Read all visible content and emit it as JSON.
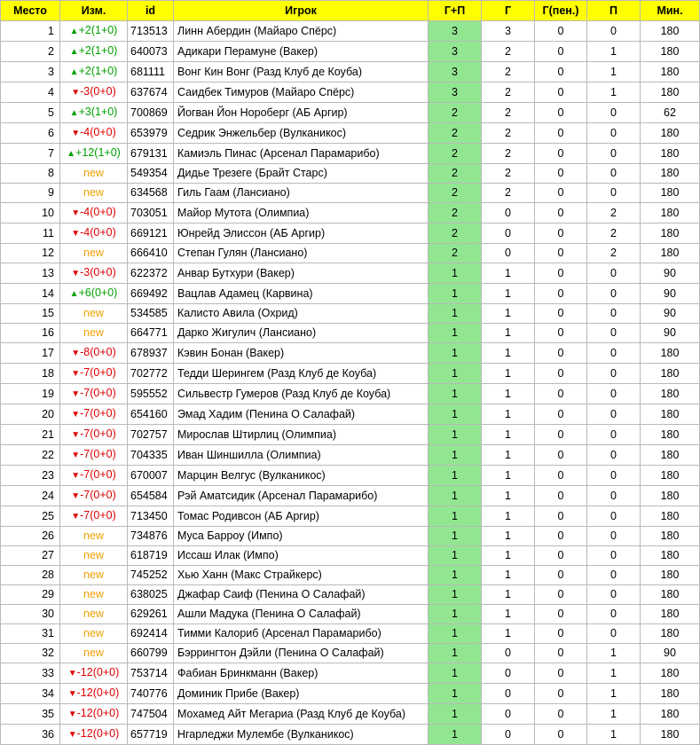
{
  "headers": [
    "Место",
    "Изм.",
    "id",
    "Игрок",
    "Г+П",
    "Г",
    "Г(пен.)",
    "П",
    "Мин."
  ],
  "rows": [
    {
      "place": "1",
      "dir": "up",
      "change": "+2(1+0)",
      "id": "713513",
      "player": "Линн Абердин (Майаро Спёрс)",
      "gp": "3",
      "g": "3",
      "gpen": "0",
      "p": "0",
      "min": "180"
    },
    {
      "place": "2",
      "dir": "up",
      "change": "+2(1+0)",
      "id": "640073",
      "player": "Адикари Перамуне (Вакер)",
      "gp": "3",
      "g": "2",
      "gpen": "0",
      "p": "1",
      "min": "180"
    },
    {
      "place": "3",
      "dir": "up",
      "change": "+2(1+0)",
      "id": "681111",
      "player": "Вонг Кин Вонг (Разд Клуб де Коуба)",
      "gp": "3",
      "g": "2",
      "gpen": "0",
      "p": "1",
      "min": "180"
    },
    {
      "place": "4",
      "dir": "down",
      "change": "-3(0+0)",
      "id": "637674",
      "player": "Саидбек Тимуров (Майаро Спёрс)",
      "gp": "3",
      "g": "2",
      "gpen": "0",
      "p": "1",
      "min": "180"
    },
    {
      "place": "5",
      "dir": "up",
      "change": "+3(1+0)",
      "id": "700869",
      "player": "Йогван Йон Нороберг (АБ Аргир)",
      "gp": "2",
      "g": "2",
      "gpen": "0",
      "p": "0",
      "min": "62"
    },
    {
      "place": "6",
      "dir": "down",
      "change": "-4(0+0)",
      "id": "653979",
      "player": "Седрик Энжельбер (Вулканикос)",
      "gp": "2",
      "g": "2",
      "gpen": "0",
      "p": "0",
      "min": "180"
    },
    {
      "place": "7",
      "dir": "up",
      "change": "+12(1+0)",
      "id": "679131",
      "player": "Камиэль Пинас (Арсенал Парамарибо)",
      "gp": "2",
      "g": "2",
      "gpen": "0",
      "p": "0",
      "min": "180"
    },
    {
      "place": "8",
      "dir": "new",
      "change": "new",
      "id": "549354",
      "player": "Дидье Трезеге (Брайт Старс)",
      "gp": "2",
      "g": "2",
      "gpen": "0",
      "p": "0",
      "min": "180"
    },
    {
      "place": "9",
      "dir": "new",
      "change": "new",
      "id": "634568",
      "player": "Гиль Гаам (Лансиано)",
      "gp": "2",
      "g": "2",
      "gpen": "0",
      "p": "0",
      "min": "180"
    },
    {
      "place": "10",
      "dir": "down",
      "change": "-4(0+0)",
      "id": "703051",
      "player": "Майор Мутота (Олимпиа)",
      "gp": "2",
      "g": "0",
      "gpen": "0",
      "p": "2",
      "min": "180"
    },
    {
      "place": "11",
      "dir": "down",
      "change": "-4(0+0)",
      "id": "669121",
      "player": "Юнрейд Элиссон (АБ Аргир)",
      "gp": "2",
      "g": "0",
      "gpen": "0",
      "p": "2",
      "min": "180"
    },
    {
      "place": "12",
      "dir": "new",
      "change": "new",
      "id": "666410",
      "player": "Степан Гулян (Лансиано)",
      "gp": "2",
      "g": "0",
      "gpen": "0",
      "p": "2",
      "min": "180"
    },
    {
      "place": "13",
      "dir": "down",
      "change": "-3(0+0)",
      "id": "622372",
      "player": "Анвар Бутхури (Вакер)",
      "gp": "1",
      "g": "1",
      "gpen": "0",
      "p": "0",
      "min": "90"
    },
    {
      "place": "14",
      "dir": "up",
      "change": "+6(0+0)",
      "id": "669492",
      "player": "Вацлав Адамец (Карвина)",
      "gp": "1",
      "g": "1",
      "gpen": "0",
      "p": "0",
      "min": "90"
    },
    {
      "place": "15",
      "dir": "new",
      "change": "new",
      "id": "534585",
      "player": "Калисто Авила (Охрид)",
      "gp": "1",
      "g": "1",
      "gpen": "0",
      "p": "0",
      "min": "90"
    },
    {
      "place": "16",
      "dir": "new",
      "change": "new",
      "id": "664771",
      "player": "Дарко Жигулич (Лансиано)",
      "gp": "1",
      "g": "1",
      "gpen": "0",
      "p": "0",
      "min": "90"
    },
    {
      "place": "17",
      "dir": "down",
      "change": "-8(0+0)",
      "id": "678937",
      "player": "Кэвин Бонан (Вакер)",
      "gp": "1",
      "g": "1",
      "gpen": "0",
      "p": "0",
      "min": "180"
    },
    {
      "place": "18",
      "dir": "down",
      "change": "-7(0+0)",
      "id": "702772",
      "player": "Тедди Шерингем (Разд Клуб де Коуба)",
      "gp": "1",
      "g": "1",
      "gpen": "0",
      "p": "0",
      "min": "180"
    },
    {
      "place": "19",
      "dir": "down",
      "change": "-7(0+0)",
      "id": "595552",
      "player": "Сильвестр Гумеров (Разд Клуб де Коуба)",
      "gp": "1",
      "g": "1",
      "gpen": "0",
      "p": "0",
      "min": "180"
    },
    {
      "place": "20",
      "dir": "down",
      "change": "-7(0+0)",
      "id": "654160",
      "player": "Эмад Хадим (Пенина О Салафай)",
      "gp": "1",
      "g": "1",
      "gpen": "0",
      "p": "0",
      "min": "180"
    },
    {
      "place": "21",
      "dir": "down",
      "change": "-7(0+0)",
      "id": "702757",
      "player": "Мирослав Штирлиц (Олимпиа)",
      "gp": "1",
      "g": "1",
      "gpen": "0",
      "p": "0",
      "min": "180"
    },
    {
      "place": "22",
      "dir": "down",
      "change": "-7(0+0)",
      "id": "704335",
      "player": "Иван Шиншилла (Олимпиа)",
      "gp": "1",
      "g": "1",
      "gpen": "0",
      "p": "0",
      "min": "180"
    },
    {
      "place": "23",
      "dir": "down",
      "change": "-7(0+0)",
      "id": "670007",
      "player": "Марцин Велгус (Вулканикос)",
      "gp": "1",
      "g": "1",
      "gpen": "0",
      "p": "0",
      "min": "180"
    },
    {
      "place": "24",
      "dir": "down",
      "change": "-7(0+0)",
      "id": "654584",
      "player": "Рэй Аматсидик (Арсенал Парамарибо)",
      "gp": "1",
      "g": "1",
      "gpen": "0",
      "p": "0",
      "min": "180"
    },
    {
      "place": "25",
      "dir": "down",
      "change": "-7(0+0)",
      "id": "713450",
      "player": "Томас Родивсон (АБ Аргир)",
      "gp": "1",
      "g": "1",
      "gpen": "0",
      "p": "0",
      "min": "180"
    },
    {
      "place": "26",
      "dir": "new",
      "change": "new",
      "id": "734876",
      "player": "Муса Барроу (Импо)",
      "gp": "1",
      "g": "1",
      "gpen": "0",
      "p": "0",
      "min": "180"
    },
    {
      "place": "27",
      "dir": "new",
      "change": "new",
      "id": "618719",
      "player": "Иссаш Илак (Импо)",
      "gp": "1",
      "g": "1",
      "gpen": "0",
      "p": "0",
      "min": "180"
    },
    {
      "place": "28",
      "dir": "new",
      "change": "new",
      "id": "745252",
      "player": "Хью Ханн (Макс Страйкерс)",
      "gp": "1",
      "g": "1",
      "gpen": "0",
      "p": "0",
      "min": "180"
    },
    {
      "place": "29",
      "dir": "new",
      "change": "new",
      "id": "638025",
      "player": "Джафар Саиф (Пенина О Салафай)",
      "gp": "1",
      "g": "1",
      "gpen": "0",
      "p": "0",
      "min": "180"
    },
    {
      "place": "30",
      "dir": "new",
      "change": "new",
      "id": "629261",
      "player": "Ашли Мадука (Пенина О Салафай)",
      "gp": "1",
      "g": "1",
      "gpen": "0",
      "p": "0",
      "min": "180"
    },
    {
      "place": "31",
      "dir": "new",
      "change": "new",
      "id": "692414",
      "player": "Тимми Калориб (Арсенал Парамарибо)",
      "gp": "1",
      "g": "1",
      "gpen": "0",
      "p": "0",
      "min": "180"
    },
    {
      "place": "32",
      "dir": "new",
      "change": "new",
      "id": "660799",
      "player": "Бэррингтон Дэйли (Пенина О Салафай)",
      "gp": "1",
      "g": "0",
      "gpen": "0",
      "p": "1",
      "min": "90"
    },
    {
      "place": "33",
      "dir": "down",
      "change": "-12(0+0)",
      "id": "753714",
      "player": "Фабиан Бринкманн (Вакер)",
      "gp": "1",
      "g": "0",
      "gpen": "0",
      "p": "1",
      "min": "180"
    },
    {
      "place": "34",
      "dir": "down",
      "change": "-12(0+0)",
      "id": "740776",
      "player": "Доминик Прибе (Вакер)",
      "gp": "1",
      "g": "0",
      "gpen": "0",
      "p": "1",
      "min": "180"
    },
    {
      "place": "35",
      "dir": "down",
      "change": "-12(0+0)",
      "id": "747504",
      "player": "Мохамед Айт Мегариа (Разд Клуб де Коуба)",
      "gp": "1",
      "g": "0",
      "gpen": "0",
      "p": "1",
      "min": "180"
    },
    {
      "place": "36",
      "dir": "down",
      "change": "-12(0+0)",
      "id": "657719",
      "player": "Нгарледжи Мулембе (Вулканикос)",
      "gp": "1",
      "g": "0",
      "gpen": "0",
      "p": "1",
      "min": "180"
    }
  ]
}
